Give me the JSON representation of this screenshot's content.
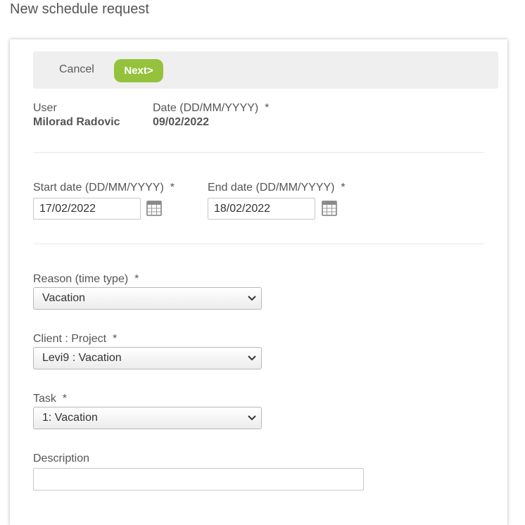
{
  "page": {
    "title": "New schedule request"
  },
  "toolbar": {
    "cancel_label": "Cancel",
    "next_label": "Next>"
  },
  "user": {
    "label": "User",
    "value": "Milorad Radovic"
  },
  "date": {
    "label": "Date (DD/MM/YYYY)",
    "required_mark": "*",
    "value": "09/02/2022"
  },
  "start_date": {
    "label": "Start date (DD/MM/YYYY)",
    "required_mark": "*",
    "value": "17/02/2022"
  },
  "end_date": {
    "label": "End date (DD/MM/YYYY)",
    "required_mark": "*",
    "value": "18/02/2022"
  },
  "reason": {
    "label": "Reason (time type)",
    "required_mark": "*",
    "selected": "Vacation"
  },
  "client_project": {
    "label": "Client : Project",
    "required_mark": "*",
    "selected": "Levi9 : Vacation"
  },
  "task": {
    "label": "Task",
    "required_mark": "*",
    "selected": "1: Vacation"
  },
  "description": {
    "label": "Description",
    "value": ""
  },
  "colors": {
    "accent": "#95c23d",
    "toolbar_bg": "#efefef",
    "text": "#555555"
  },
  "icons": {
    "calendar": "calendar-icon",
    "dropdown": "chevron-down-icon"
  }
}
